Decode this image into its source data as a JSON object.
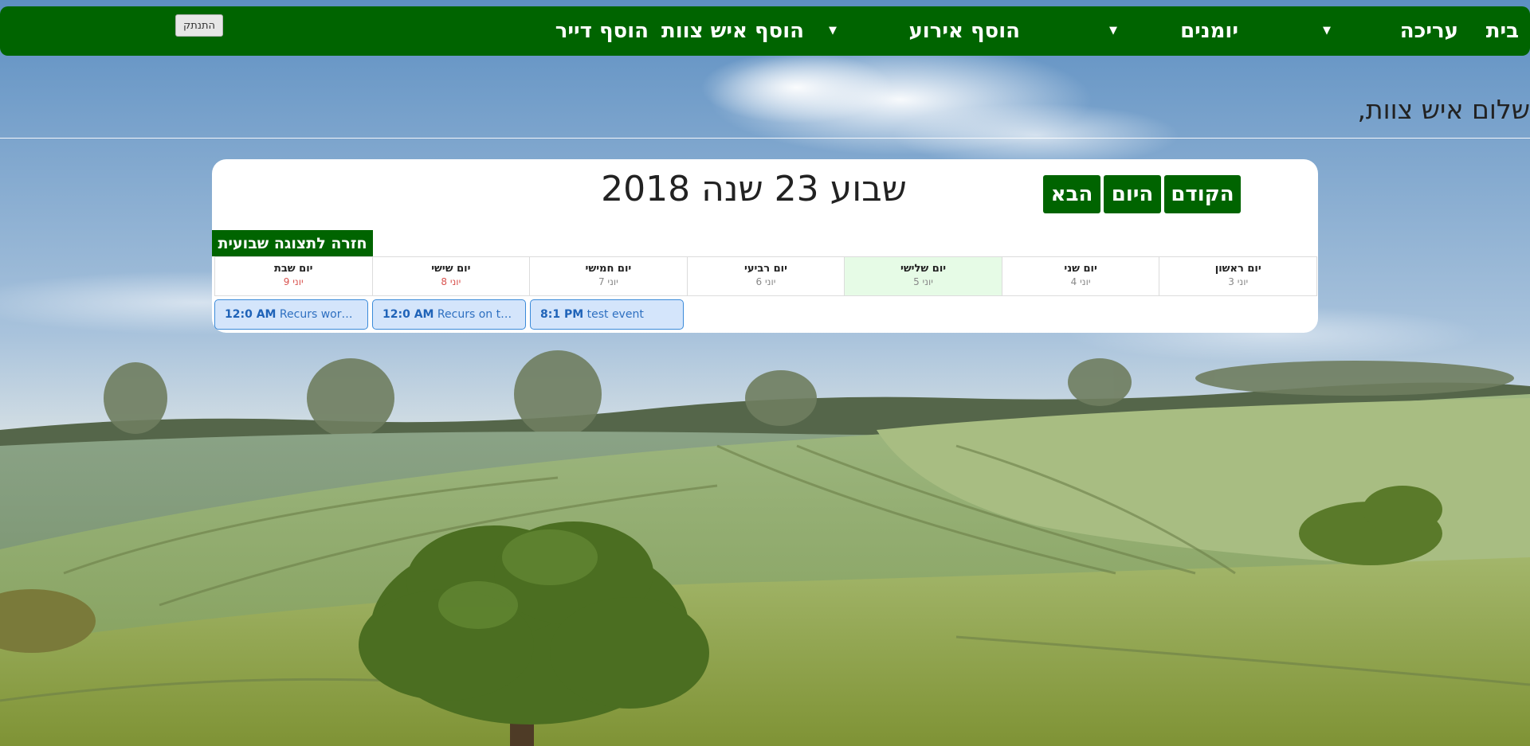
{
  "nav": {
    "home": "בית",
    "edit": "עריכה",
    "diaries": "יומנים",
    "add_event": "הוסף אירוע",
    "add_staff": "הוסף איש צוות",
    "add_resident": "הוסף דייר",
    "caret": "▼",
    "logout": "התנתק"
  },
  "greeting": "שלום איש צוות,",
  "calendar": {
    "title": "שבוע 23 שנה 2018",
    "prev_label": "הקודם",
    "today_label": "היום",
    "next_label": "הבא",
    "back_to_weekly": "חזרה לתצוגה שבועית",
    "days": [
      {
        "name": "יום ראשון",
        "date": "יוני 3"
      },
      {
        "name": "יום שני",
        "date": "יוני 4"
      },
      {
        "name": "יום שלישי",
        "date": "יוני 5"
      },
      {
        "name": "יום רביעי",
        "date": "יוני 6"
      },
      {
        "name": "יום חמישי",
        "date": "יוני 7"
      },
      {
        "name": "יום שישי",
        "date": "יוני 8"
      },
      {
        "name": "יום שבת",
        "date": "יוני 9"
      }
    ],
    "events": [
      {
        "time": "12:0 AM",
        "title": "Recurs works..."
      },
      {
        "time": "12:0 AM",
        "title": "Recurs on the..."
      },
      {
        "time": "8:1 PM",
        "title": "test event"
      }
    ]
  },
  "colors": {
    "nav_green": "#006400",
    "today_highlight": "#e6fbe6",
    "event_fill": "#d4e5fb",
    "event_border": "#3a8ad9",
    "weekend_date": "#d9534f"
  }
}
